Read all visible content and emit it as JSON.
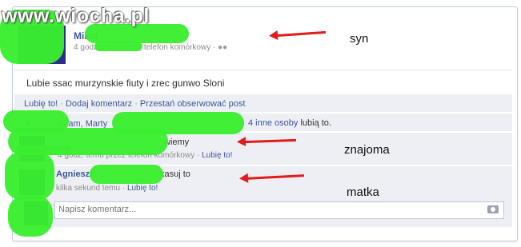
{
  "watermark": "www.wiocha.pl",
  "post": {
    "author": "Mikoł",
    "meta": "4 godz. temu przez telefon komórkowy",
    "meta_sep": " · ",
    "message": "Lubie ssac murzynskie fiuty i zrec gunwo Sloni"
  },
  "actions": {
    "like": "Lubię to!",
    "comment": "Dodaj komentarz",
    "unfollow": "Przestań obserwować post",
    "sep": " · "
  },
  "likes_row": {
    "names": "Adam, Marty",
    "others": "4 inne osoby",
    "suffix": "lubią to."
  },
  "comment1": {
    "text": "wiemy",
    "meta": "4 godz. temu przez telefon komórkowy",
    "like": "Lubię to!",
    "sep": " · "
  },
  "comment2": {
    "author": "Agnieszk",
    "text": "kasuj to",
    "meta": "kilka sekund temu",
    "like": "Lubię to!",
    "sep": " · "
  },
  "composer": {
    "placeholder": "Napisz komentarz..."
  },
  "annotations": {
    "first": "syn",
    "second": "znajoma",
    "third": "matka"
  },
  "colors": {
    "link": "#3b5998",
    "censor": "#39ee2f",
    "arrow": "#e21b1b"
  }
}
